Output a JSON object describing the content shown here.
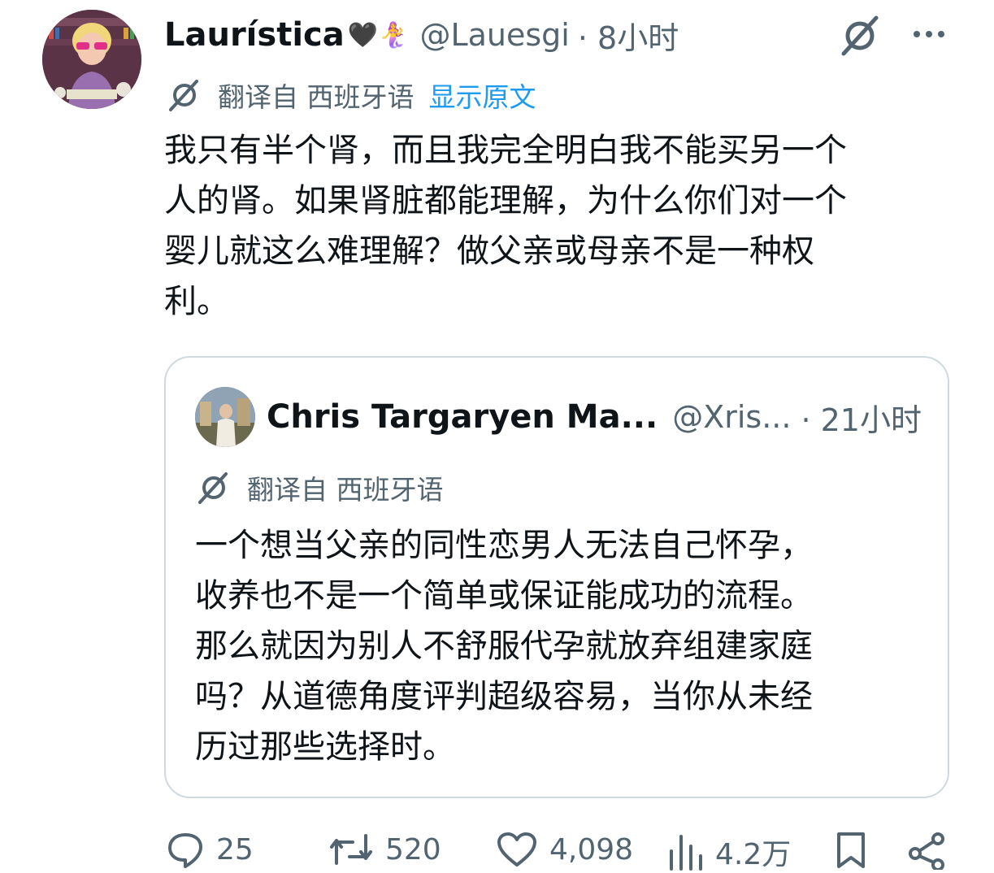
{
  "tweet": {
    "author": {
      "display_name": "Laurística",
      "name_emoji": "🖤🧜‍♀️",
      "handle": "@Lauesgi",
      "time": "· 8小时"
    },
    "translation": {
      "label": "翻译自 西班牙语",
      "show_original": "显示原文"
    },
    "text_lines": [
      "我只有半个肾，而且我完全明白我不能买另一个",
      "人的肾。如果肾脏都能理解，为什么你们对一个",
      "婴儿就这么难理解？做父亲或母亲不是一种权",
      "利。"
    ]
  },
  "quoted_tweet": {
    "author": {
      "display_name": "Chris Targaryen Ma...",
      "handle": "@Xris...",
      "time": "· 21小时"
    },
    "translation": {
      "label": "翻译自 西班牙语"
    },
    "text_lines": [
      "一个想当父亲的同性恋男人无法自己怀孕，",
      "收养也不是一个简单或保证能成功的流程。",
      "那么就因为别人不舒服代孕就放弃组建家庭",
      "吗？从道德角度评判超级容易，当你从未经",
      "历过那些选择时。"
    ]
  },
  "actions": {
    "replies": "25",
    "retweets": "520",
    "likes": "4,098",
    "views": "4.2万"
  },
  "icons": {
    "grok": "grok-icon",
    "more": "more-icon",
    "translate": "grok-icon",
    "reply": "reply-icon",
    "retweet": "retweet-icon",
    "like": "heart-icon",
    "views": "views-icon",
    "bookmark": "bookmark-icon",
    "share": "share-icon"
  },
  "colors": {
    "text": "#0f1419",
    "secondary": "#536471",
    "link": "#1d9bf0",
    "border": "#cfd9de"
  }
}
